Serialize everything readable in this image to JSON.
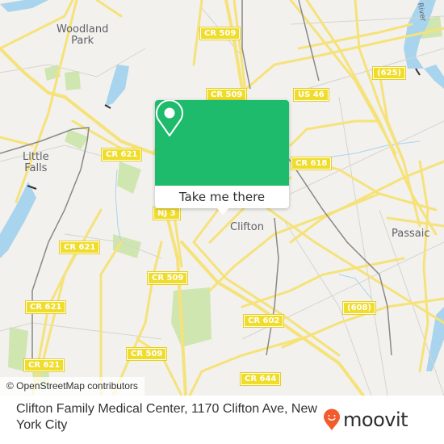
{
  "map": {
    "places": [
      {
        "name": "Woodland Park",
        "lines": [
          "Woodland",
          "Park"
        ]
      },
      {
        "name": "Little Falls",
        "lines": [
          "Little",
          "Falls"
        ]
      },
      {
        "name": "Clifton",
        "lines": [
          "Clifton"
        ]
      },
      {
        "name": "Passaic",
        "lines": [
          "Passaic"
        ]
      }
    ],
    "road_shields": [
      "CR 509",
      "CR 509",
      "US 46",
      "(625)",
      "CR 621",
      "CR 618",
      "NJ 3",
      "CR 621",
      "CR 509",
      "CR 621",
      "CR 602",
      "(608)",
      "CR 621",
      "CR 509",
      "CR 644"
    ],
    "water_label": "River",
    "attribution": "© OpenStreetMap contributors",
    "colors": {
      "land": "#f2f1ed",
      "road": "#f6e27a",
      "water": "#a8d4ee",
      "park": "#cfe6b0",
      "shield": "#f0dc2a"
    }
  },
  "popup": {
    "icon": "location-pin-icon",
    "action_label": "Take me there",
    "accent_color": "#1dbb6b"
  },
  "footer": {
    "title": "Clifton Family Medical Center, 1170 Clifton Ave, New York City",
    "brand": "moovit",
    "brand_icon": "moovit-smiley-pin-icon",
    "brand_color": "#f25c2c"
  }
}
